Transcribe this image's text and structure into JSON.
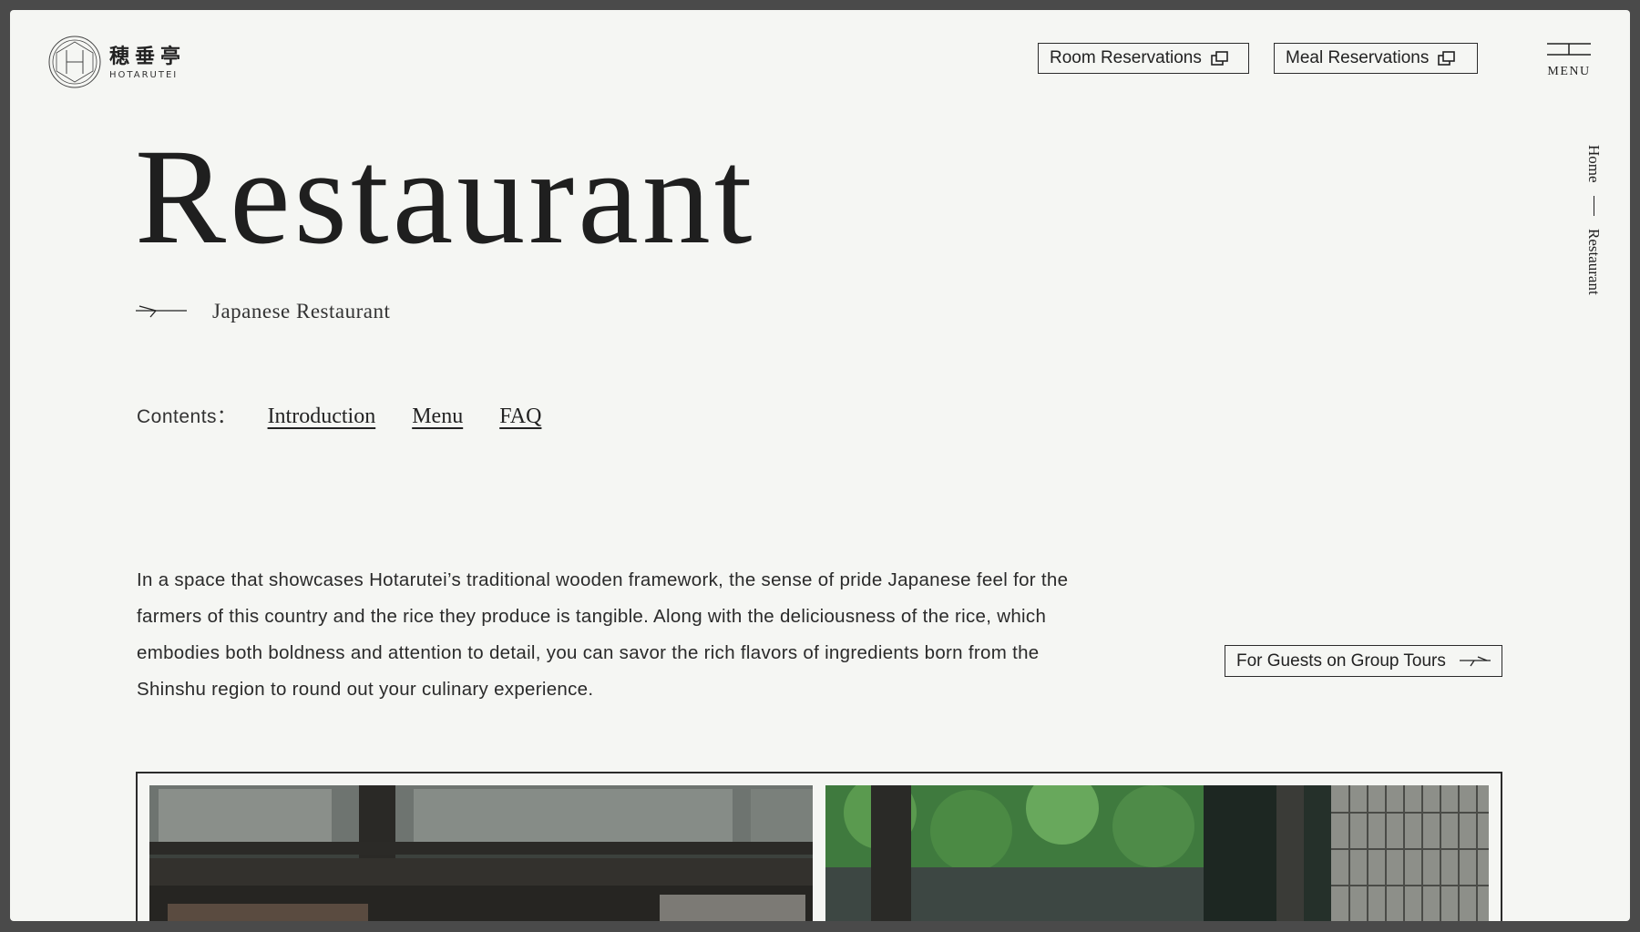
{
  "brand": {
    "kanji": "穂垂亭",
    "roman": "HOTARUTEI",
    "logo_letter": "H"
  },
  "header": {
    "room_reservations": "Room Reservations",
    "meal_reservations": "Meal Reservations",
    "menu_label": "MENU"
  },
  "breadcrumb": {
    "home": "Home",
    "current": "Restaurant"
  },
  "page": {
    "title": "Restaurant",
    "subtitle": "Japanese Restaurant"
  },
  "contents": {
    "label": "Contents：",
    "links": [
      "Introduction",
      "Menu",
      "FAQ"
    ]
  },
  "intro": {
    "text": "In a space that showcases Hotarutei’s traditional wooden framework, the sense of pride Japanese feel for the farmers of this country and the rice they produce is tangible. Along with the deliciousness of the rice, which embodies both boldness and attention to detail, you can savor the rich flavors of ingredients born from the Shinshu region to round out your culinary experience."
  },
  "group_tours": {
    "label": "For Guests on Group Tours"
  },
  "colors": {
    "background": "#f5f6f3",
    "ink": "#222222",
    "frame": "#4a4a4a"
  }
}
